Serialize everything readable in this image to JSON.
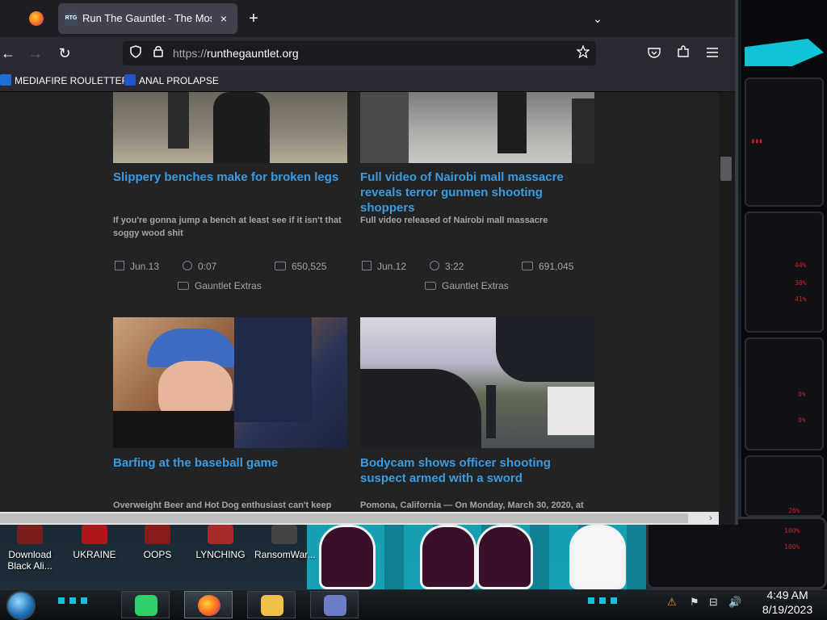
{
  "browser": {
    "tab_title": "Run The Gauntlet - The Most D",
    "tab_favicon": "RTG",
    "new_tab_icon": "+",
    "close_tab_icon": "×",
    "tab_list_icon": "⌄",
    "url_scheme": "https://",
    "url_host": "runthegauntlet.org",
    "nav": {
      "back": "←",
      "forward": "→",
      "reload": "↻"
    },
    "icons": {
      "shield": "shield-icon",
      "lock": "lock-icon",
      "star": "star-icon",
      "pocket": "pocket-icon",
      "extensions": "puzzle-icon",
      "menu": "hamburger-icon"
    },
    "bookmarks": [
      {
        "label": "MEDIAFIRE ROULETTER",
        "icon_color": "#1f6fd6"
      },
      {
        "label": "ANAL PROLAPSE",
        "icon_color": "#1e55c8"
      }
    ]
  },
  "videos": [
    {
      "title": "Slippery benches make for broken legs",
      "description": "If you're gonna jump a bench at least see if it isn't that soggy wood shit",
      "date": "Jun.13",
      "duration": "0:07",
      "views": "650,525",
      "category": "Gauntlet Extras"
    },
    {
      "title": "Full video of Nairobi mall massacre reveals terror gunmen shooting shoppers",
      "description": "Full video released of Nairobi mall massacre",
      "date": "Jun.12",
      "duration": "3:22",
      "views": "691,045",
      "category": "Gauntlet Extras"
    },
    {
      "title": "Barfing at the baseball game",
      "description": "Overweight Beer and Hot Dog enthusiast can't keep"
    },
    {
      "title": "Bodycam shows officer shooting suspect armed with a sword",
      "description": "Pomona, California — On Monday, March 30, 2020, at"
    }
  ],
  "desktop_icons": [
    {
      "label": "Download Black Ali...",
      "icon_color": "#7a1d1d"
    },
    {
      "label": "UKRAINE",
      "icon_color": "#b0161b"
    },
    {
      "label": "OOPS",
      "icon_color": "#8a1b1b"
    },
    {
      "label": "LYNCHING",
      "icon_color": "#a52a2a"
    },
    {
      "label": "RansomWar...",
      "icon_color": "#444"
    }
  ],
  "taskbar": {
    "apps": [
      {
        "name": "notes-app",
        "color": "#2fd06a"
      },
      {
        "name": "firefox",
        "color": "#ff7a1f"
      },
      {
        "name": "file-explorer",
        "color": "#f2c04a"
      },
      {
        "name": "settings-app",
        "color": "#6d7cc7"
      }
    ],
    "clock_time": "4:49 AM",
    "clock_date": "8/19/2023",
    "tray": {
      "flag": "⚑",
      "network": "⊟",
      "volume": "🔊"
    }
  },
  "gadget": {
    "readings": [
      "44%",
      "38%",
      "41%",
      "0%",
      "0%",
      "26%",
      "100%",
      "100%"
    ]
  }
}
